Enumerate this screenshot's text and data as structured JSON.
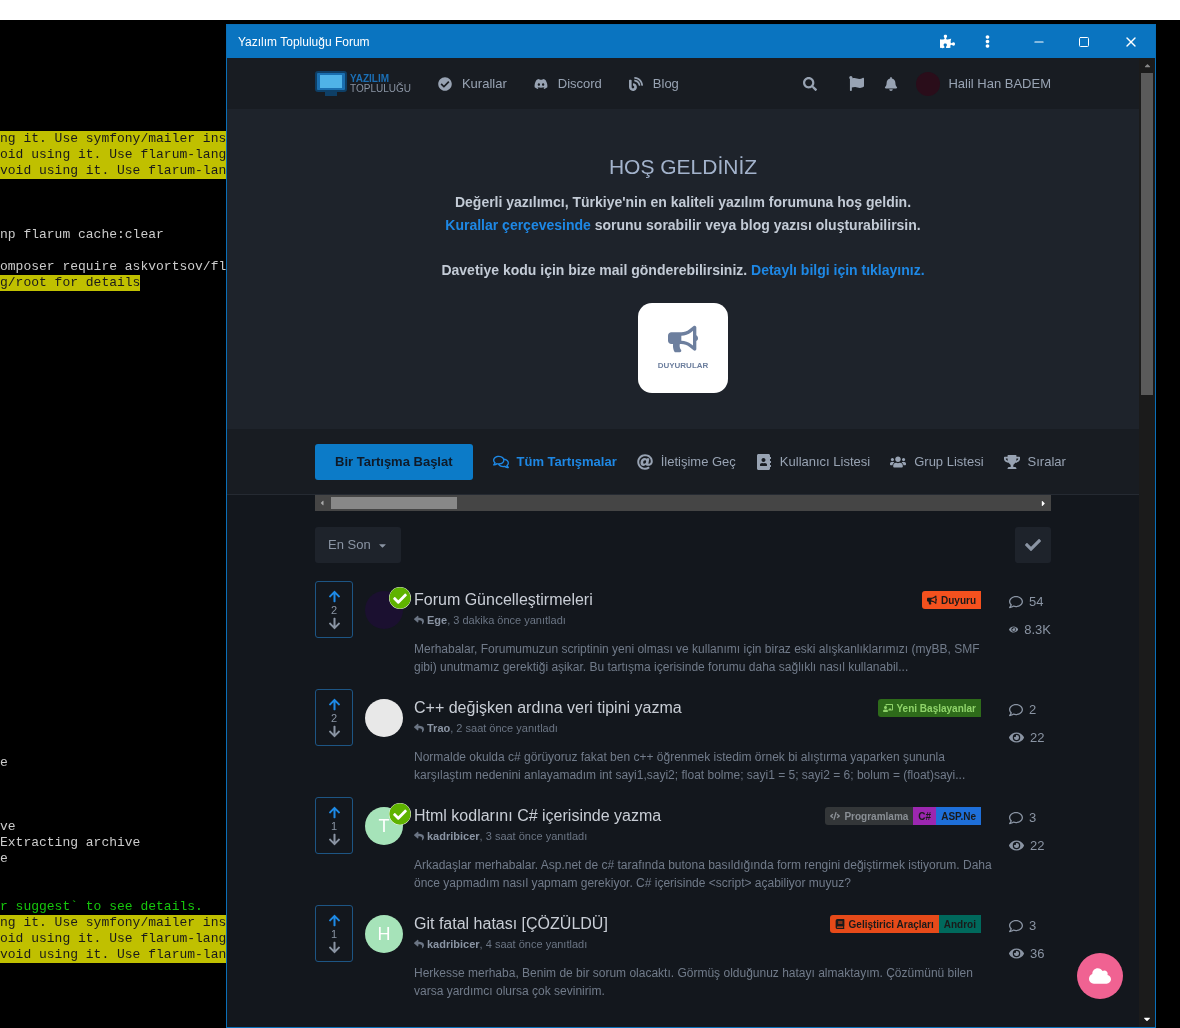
{
  "terminal": {
    "lines": [
      {
        "kind": "warning",
        "text": "ng it. Use symfony/mailer ins"
      },
      {
        "kind": "warning",
        "text": "oid using it. Use flarum-lang"
      },
      {
        "kind": "warning",
        "text": "void using it. Use flarum-lan"
      },
      {
        "kind": "plain",
        "text": "np flarum cache:clear"
      },
      {
        "kind": "plain",
        "text": "omposer require askvortsov/fl"
      },
      {
        "kind": "warning",
        "text": "g/root for details"
      },
      {
        "kind": "plain",
        "text": "e"
      },
      {
        "kind": "plain",
        "text": "ve"
      },
      {
        "kind": "plain",
        "text": "Extracting archive"
      },
      {
        "kind": "plain",
        "text": "e"
      },
      {
        "kind": "success",
        "text": "r suggest` to see details."
      },
      {
        "kind": "warning",
        "text": "ng it. Use symfony/mailer ins"
      },
      {
        "kind": "warning",
        "text": "oid using it. Use flarum-lang"
      },
      {
        "kind": "warning",
        "text": "void using it. Use flarum-lan"
      }
    ]
  },
  "window": {
    "title": "Yazılım Topluluğu Forum"
  },
  "header": {
    "logo": {
      "line_1": "YAZILIM",
      "line_2": "TOPLULUĞU"
    },
    "links": [
      "Kurallar",
      "Discord",
      "Blog"
    ],
    "user": "Halil Han BADEM"
  },
  "hero": {
    "title": "HOŞ GELDİNİZ",
    "paragraphs": [
      [
        {
          "text": "Değerli yazılımcı, Türkiye'nin en kaliteli yazılım forumuna hoş geldin.",
          "link": false
        },
        {
          "text": "Kurallar çerçevesinde",
          "link": true
        },
        {
          "text": "sorunu sorabilir veya blog yazısı oluşturabilirsin.",
          "link": false
        }
      ],
      [
        {
          "text": "Davetiye kodu için bize mail gönderebilirsiniz.",
          "link": false
        },
        {
          "text": "Detaylı bilgi için tıklayınız.",
          "link": true
        }
      ]
    ],
    "card_label": "DUYURULAR"
  },
  "nav": {
    "start_button": "Bir Tartışma Başlat",
    "links": [
      {
        "label": "Tüm Tartışmalar",
        "selected": true
      },
      {
        "label": "İletişime Geç",
        "selected": false
      },
      {
        "label": "Kullanıcı Listesi",
        "selected": false
      },
      {
        "label": "Grup Listesi",
        "selected": false
      },
      {
        "label": "Sıralar",
        "selected": false
      }
    ]
  },
  "toolbar": {
    "sort": "En Son"
  },
  "discussions": [
    {
      "votes": "2",
      "solved": true,
      "title": "Forum Güncelleştirmeleri",
      "author": "Ege",
      "time": ", 3 dakika önce yanıtladı",
      "excerpt": "Merhabalar, Forumumuzun scriptinin yeni olması ve kullanımı için biraz eski alışkanlıklarımızı (myBB, SMF gibi) unutmamız gerektiği aşikar. Bu tartışma içerisinde forumu daha sağlıklı nasıl kullanabil...",
      "tags": [
        {
          "label": "Duyuru",
          "color": "#f4511e"
        }
      ],
      "replies": "54",
      "views": "8.3K"
    },
    {
      "votes": "2",
      "solved": false,
      "title": "C++ değişken ardına veri tipini yazma",
      "author": "Trao",
      "time": ", 2 saat önce yanıtladı",
      "excerpt": "Normalde okulda c# görüyoruz fakat ben c++ öğrenmek istedim örnek bi alıştırma yaparken şununla karşılaştım nedenini anlayamadım int sayi1,sayi2; float bolme; sayi1 = 5; sayi2 = 6; bolum = (float)sayi...",
      "tags": [
        {
          "label": "Yeni Başlayanlar",
          "color": "#2e6b1a"
        }
      ],
      "replies": "2",
      "views": "22"
    },
    {
      "votes": "1",
      "avatar_letter": "T",
      "solved": true,
      "title": "Html kodlarını C# içerisinde yazma",
      "author": "kadribicer",
      "time": ", 3 saat önce yanıtladı",
      "excerpt": "Arkadaşlar merhabalar. Asp.net de c# tarafında butona basıldığında form rengini değiştirmek istiyorum. Daha önce yapmadım nasıl yapmam gerekiyor. C# içerisinde <script> açabiliyor muyuz?",
      "tags": [
        {
          "label": "Programlama",
          "color": "#333638"
        },
        {
          "label": "C#",
          "color": "#9c27b0"
        },
        {
          "label": "ASP.Ne",
          "color": "#1e6fd9"
        }
      ],
      "replies": "3",
      "views": "22"
    },
    {
      "votes": "1",
      "avatar_letter": "H",
      "solved": false,
      "title": "Git fatal hatası [ÇÖZÜLDÜ]",
      "author": "kadribicer",
      "time": ", 4 saat önce yanıtladı",
      "excerpt": "Herkesse merhaba, Benim de bir sorum olacaktı. Görmüş olduğunuz hatayı almaktayım. Çözümünü bilen varsa yardımcı olursa çok sevinirim.",
      "tags": [
        {
          "label": "Geliştirici Araçları",
          "color": "#e64a19"
        },
        {
          "label": "Androi",
          "color": "#00695c"
        }
      ],
      "replies": "3",
      "views": "36"
    }
  ]
}
